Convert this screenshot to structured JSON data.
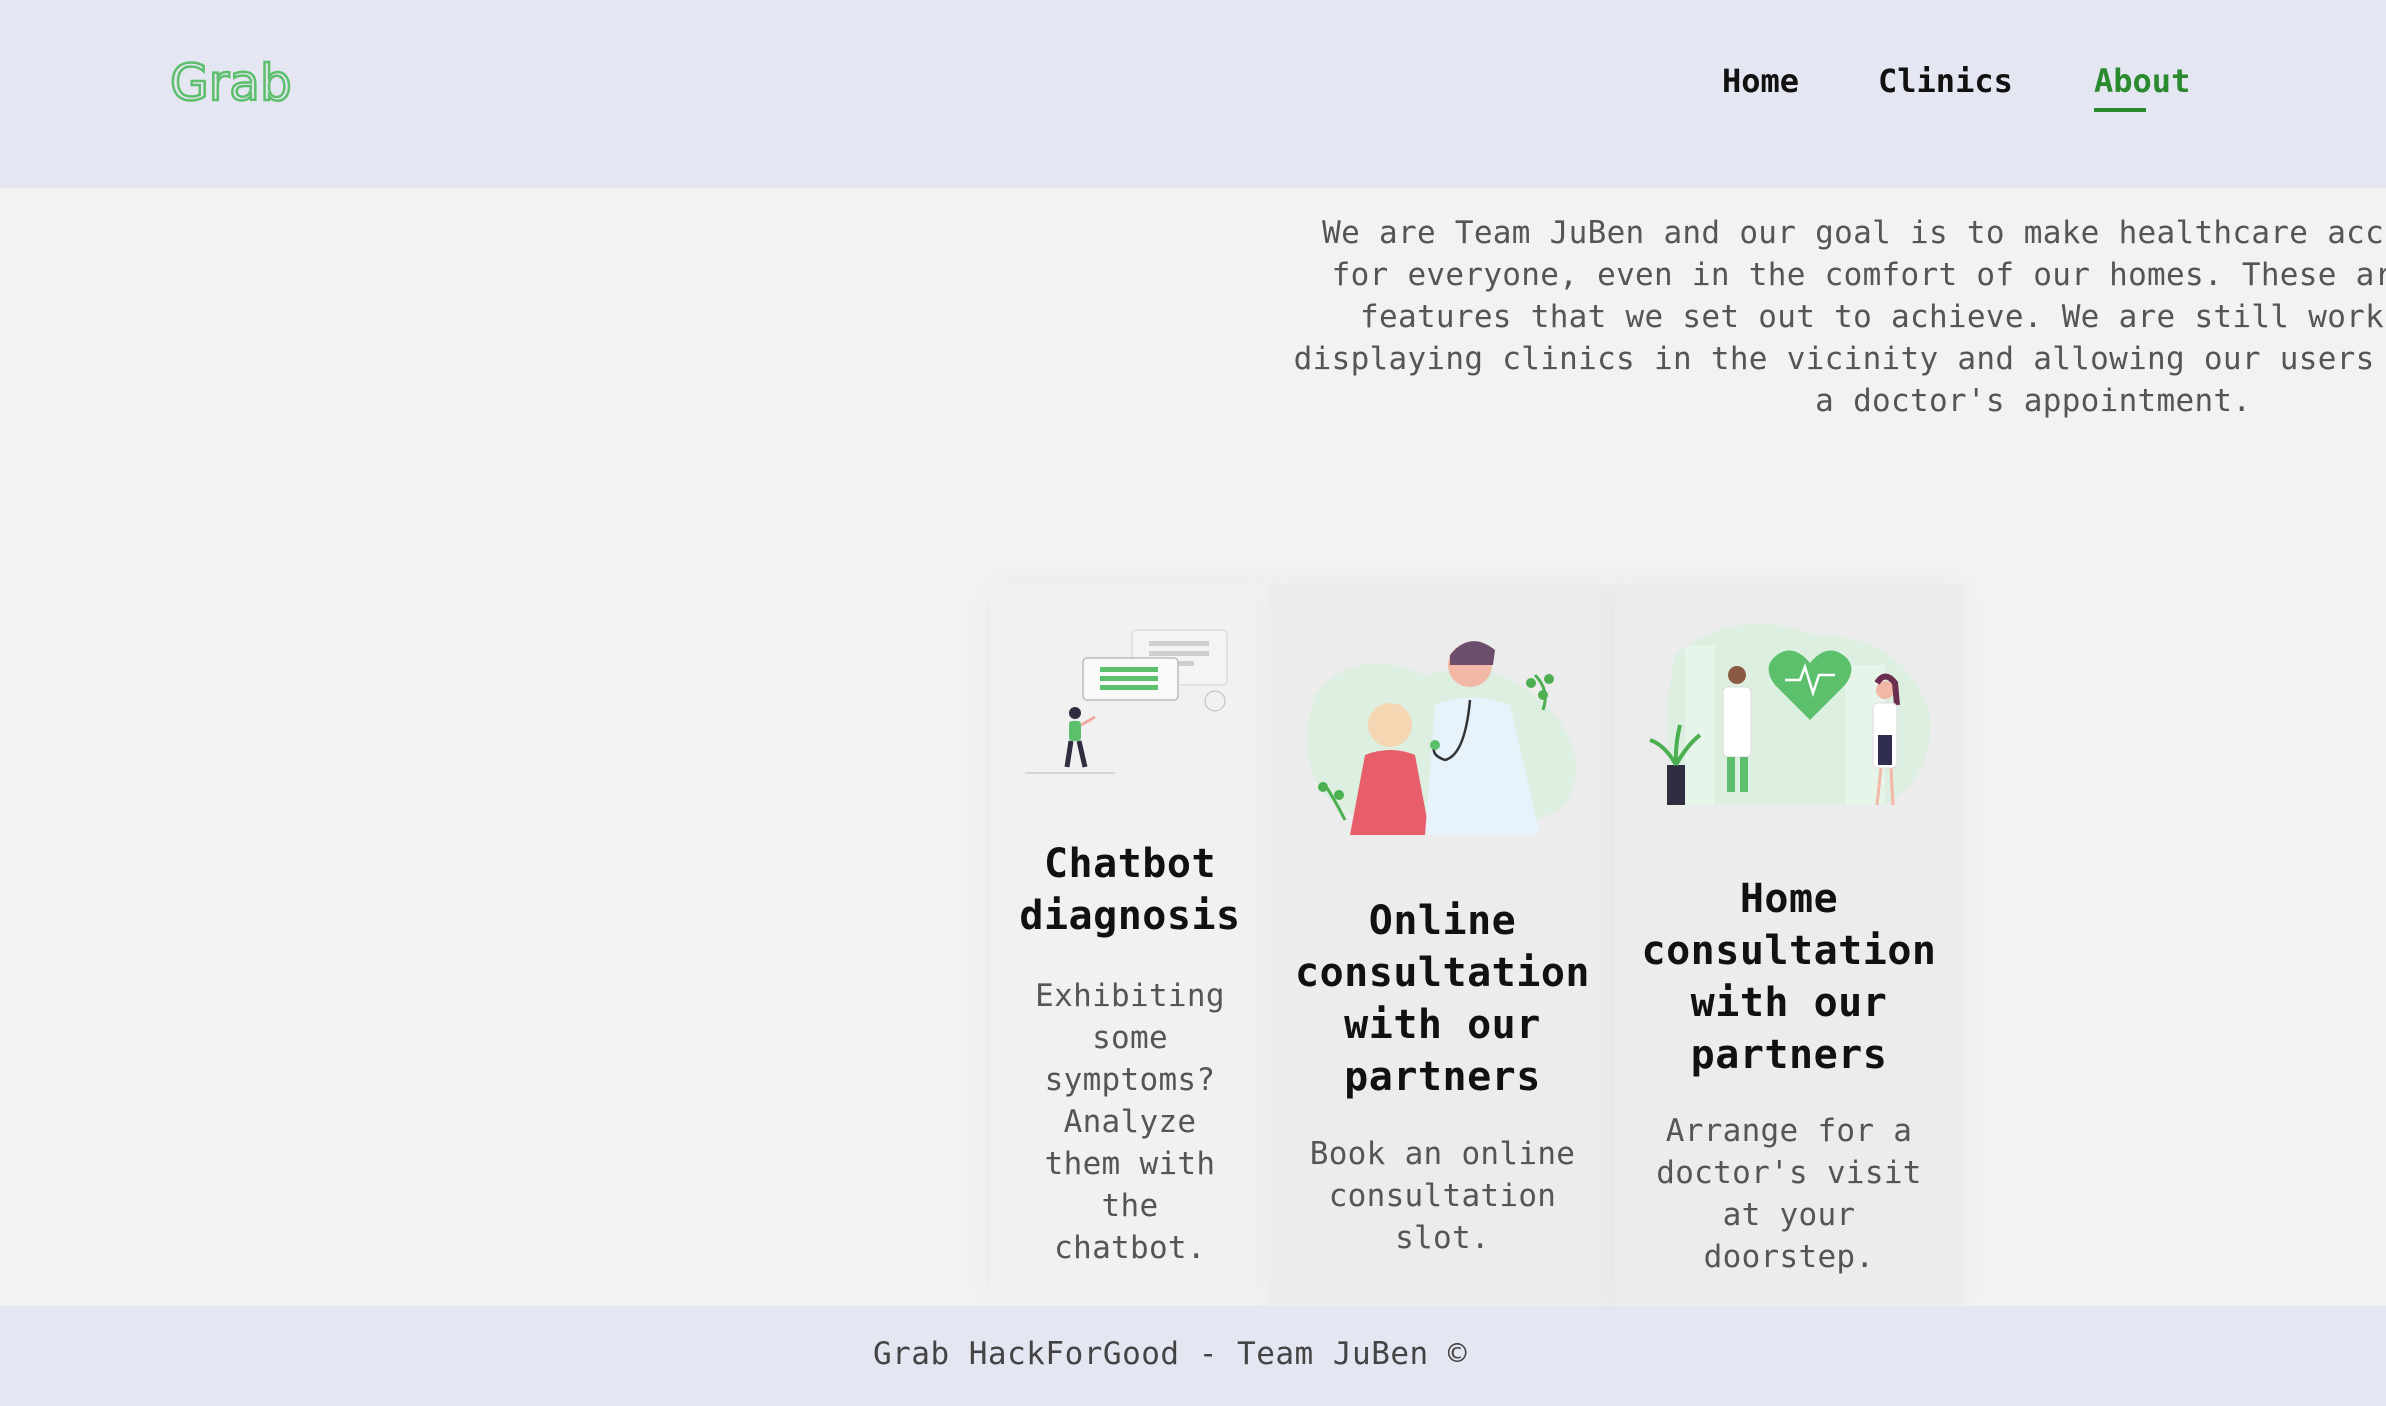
{
  "header": {
    "logo_text": "Grab",
    "nav": {
      "home": "Home",
      "clinics": "Clinics",
      "about": "About"
    }
  },
  "intro": {
    "text": " We are Team JuBen and our goal is to make healthcare accessible\nfor everyone, even in the comfort of our homes. These are the\n  features that we set out to achieve. We are still working on\ndisplaying clinics in the vicinity and allowing our users to book\n             a doctor's appointment."
  },
  "cards": [
    {
      "title": "Chatbot diagnosis",
      "description": "Exhibiting some symptoms? Analyze them with the chatbot.",
      "illustration": "chatbot-illustration"
    },
    {
      "title": "Online consultation with our partners",
      "description": "Book an online consultation slot.",
      "illustration": "online-consultation-illustration"
    },
    {
      "title": "Home consultation with our partners",
      "description": "Arrange for a doctor's visit at your doorstep.",
      "illustration": "home-consultation-illustration"
    }
  ],
  "footer": {
    "text": "Grab HackForGood - Team JuBen ©"
  },
  "colors": {
    "brand_green": "#2a8a2e",
    "header_bg": "#e4e6f2",
    "page_bg": "#f2f2f2",
    "illustration_green": "#5cbf6c"
  }
}
